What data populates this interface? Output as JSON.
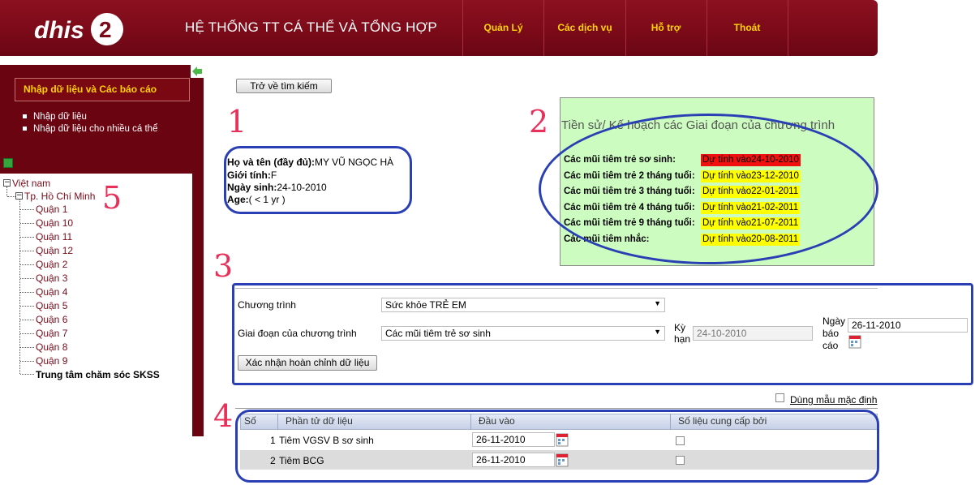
{
  "header": {
    "logo_text": "dhis2",
    "app_title": "HỆ THỐNG TT CÁ THỂ VÀ TỔNG HỢP",
    "nav": [
      "Quản Lý",
      "Các dịch vụ",
      "Hỗ trợ",
      "Thoát"
    ]
  },
  "sidebar": {
    "menu_title": "Nhập dữ liệu và Các báo cáo",
    "links": [
      "Nhập dữ liệu",
      "Nhập dữ liệu cho nhiều cá thể"
    ],
    "tree": {
      "root": "Việt nam",
      "city": "Tp. Hồ Chí Minh",
      "districts": [
        "Quận 1",
        "Quận 10",
        "Quận 11",
        "Quận 12",
        "Quận 2",
        "Quận 3",
        "Quận 4",
        "Quận 5",
        "Quận 6",
        "Quận 7",
        "Quận 8",
        "Quận 9"
      ],
      "selected": "Trung tâm chăm sóc SKSS"
    }
  },
  "back_button": "Trở về tìm kiếm",
  "annotations": [
    "1",
    "2",
    "3",
    "4",
    "5"
  ],
  "patient": {
    "name_label": "Họ và tên (đầy đủ):",
    "name_value": "MY VŨ NGỌC HÀ",
    "gender_label": "Giới tính:",
    "gender_value": "F",
    "dob_label": "Ngày sinh:",
    "dob_value": "24-10-2010",
    "age_label": "Age:",
    "age_value": "( < 1 yr )"
  },
  "schedule": {
    "title": "Tiền sử/ Kế hoạch các Giai đoạn của chương trình",
    "rows": [
      {
        "label": "Các mũi tiêm trẻ sơ sinh:",
        "value": "Dự tính vào24-10-2010",
        "color": "#f01010"
      },
      {
        "label": "Các mũi tiêm trẻ 2 tháng tuổi:",
        "value": "Dự tính vào23-12-2010",
        "color": "#ffff00"
      },
      {
        "label": "Các mũi tiêm trẻ 3 tháng tuổi:",
        "value": "Dự tính vào22-01-2011",
        "color": "#ffff00"
      },
      {
        "label": "Các mũi tiêm trẻ 4 tháng tuổi:",
        "value": "Dự tính vào21-02-2011",
        "color": "#ffff00"
      },
      {
        "label": "Các mũi tiêm trẻ 9 tháng tuổi:",
        "value": "Dự tính vào21-07-2011",
        "color": "#ffff00"
      },
      {
        "label": "Các mũi tiêm nhắc:",
        "value": "Dự tính vào20-08-2011",
        "color": "#ffff00"
      }
    ]
  },
  "program_form": {
    "program_label": "Chương trình",
    "program_value": "Sức khỏe TRẺ EM",
    "stage_label": "Giai đoạn của chương trình",
    "stage_value": "Các mũi tiêm trẻ sơ sinh",
    "period_label_1": "Kỳ",
    "period_label_2": "hạn",
    "period_value": "24-10-2010",
    "report_label_1": "Ngày",
    "report_label_2": "báo",
    "report_label_3": "cáo",
    "report_value": "26-11-2010",
    "confirm_button": "Xác nhận hoàn chỉnh dữ liệu"
  },
  "default_template_label": "Dùng mẫu mặc định",
  "table": {
    "headers": [
      "Số",
      "Phần tử dữ liệu",
      "Đầu vào",
      "Số liệu cung cấp bởi"
    ],
    "rows": [
      {
        "no": "1",
        "element": "Tiêm VGSV B sơ sinh",
        "value": "26-11-2010"
      },
      {
        "no": "2",
        "element": "Tiêm BCG",
        "value": "26-11-2010"
      }
    ]
  },
  "colors": {
    "header_bg": "#7a0a18",
    "nav_text": "#ffd400",
    "annotation_red": "#e8315a",
    "annotation_blue": "#2a3fb4",
    "schedule_bg": "#ccfcc0"
  }
}
